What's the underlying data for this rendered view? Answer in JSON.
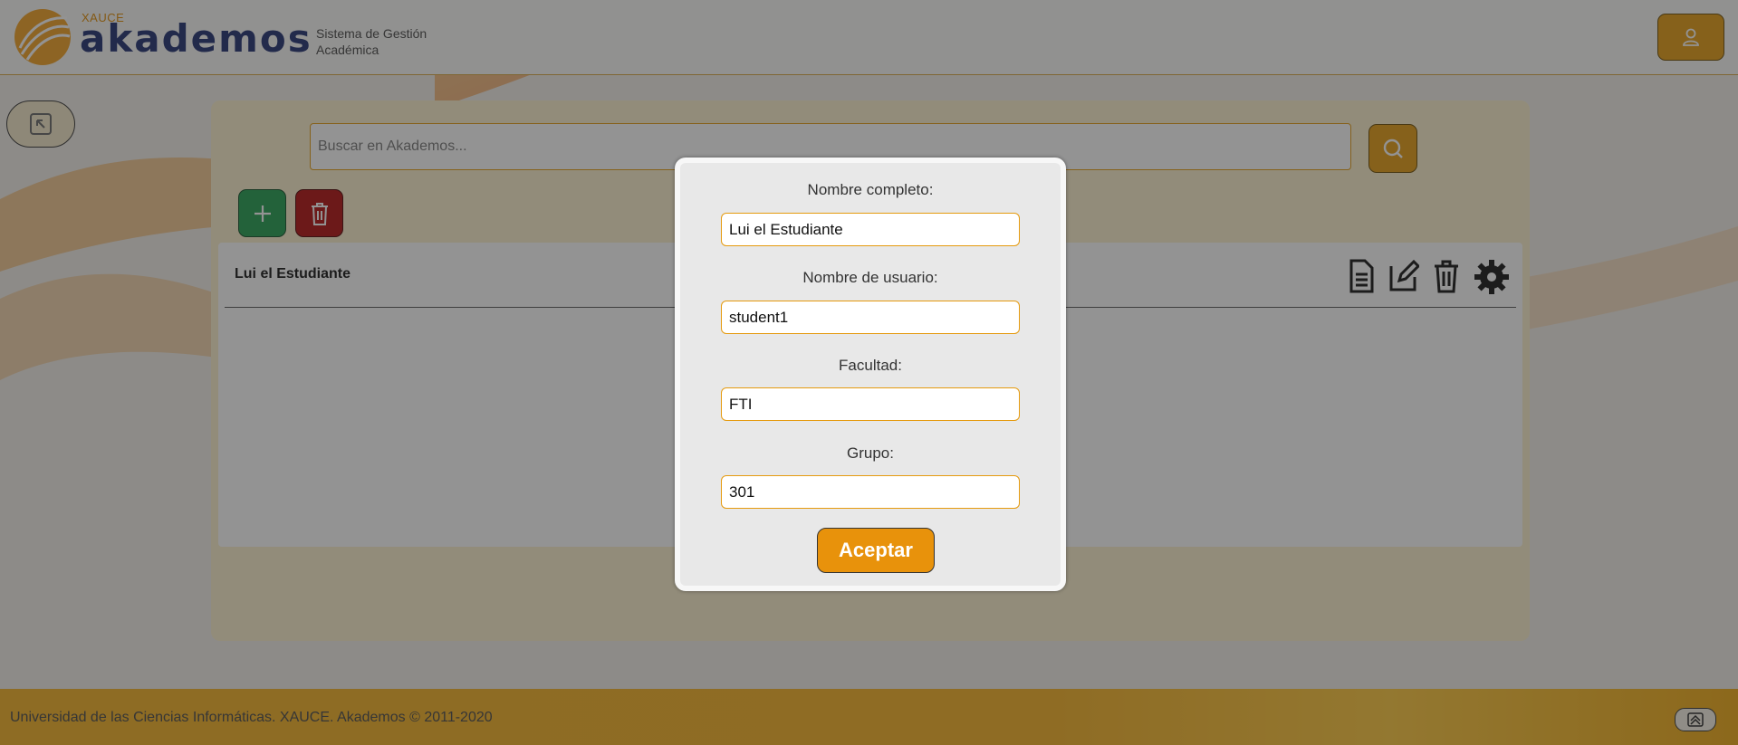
{
  "header": {
    "brand_small": "XAUCE",
    "brand": "akademos",
    "subtitle_line1": "Sistema de Gestión",
    "subtitle_line2": "Académica",
    "user_icon": "user-icon"
  },
  "search": {
    "placeholder": "Buscar en Akademos...",
    "value": ""
  },
  "list": {
    "items": [
      {
        "title": "Lui el Estudiante"
      }
    ]
  },
  "modal": {
    "fields": [
      {
        "label": "Nombre completo:",
        "value": "Lui el Estudiante"
      },
      {
        "label": "Nombre de usuario:",
        "value": "student1"
      },
      {
        "label": "Facultad:",
        "value": "FTI"
      },
      {
        "label": "Grupo:",
        "value": "301"
      }
    ],
    "accept_label": "Aceptar"
  },
  "footer": {
    "text": "Universidad de las Ciencias Informáticas. XAUCE. Akademos © 2011-2020"
  },
  "colors": {
    "accent": "#e59a0e",
    "brand_blue": "#1d2c6e",
    "add_green": "#1f9c4d",
    "delete_red": "#b10b0b"
  }
}
